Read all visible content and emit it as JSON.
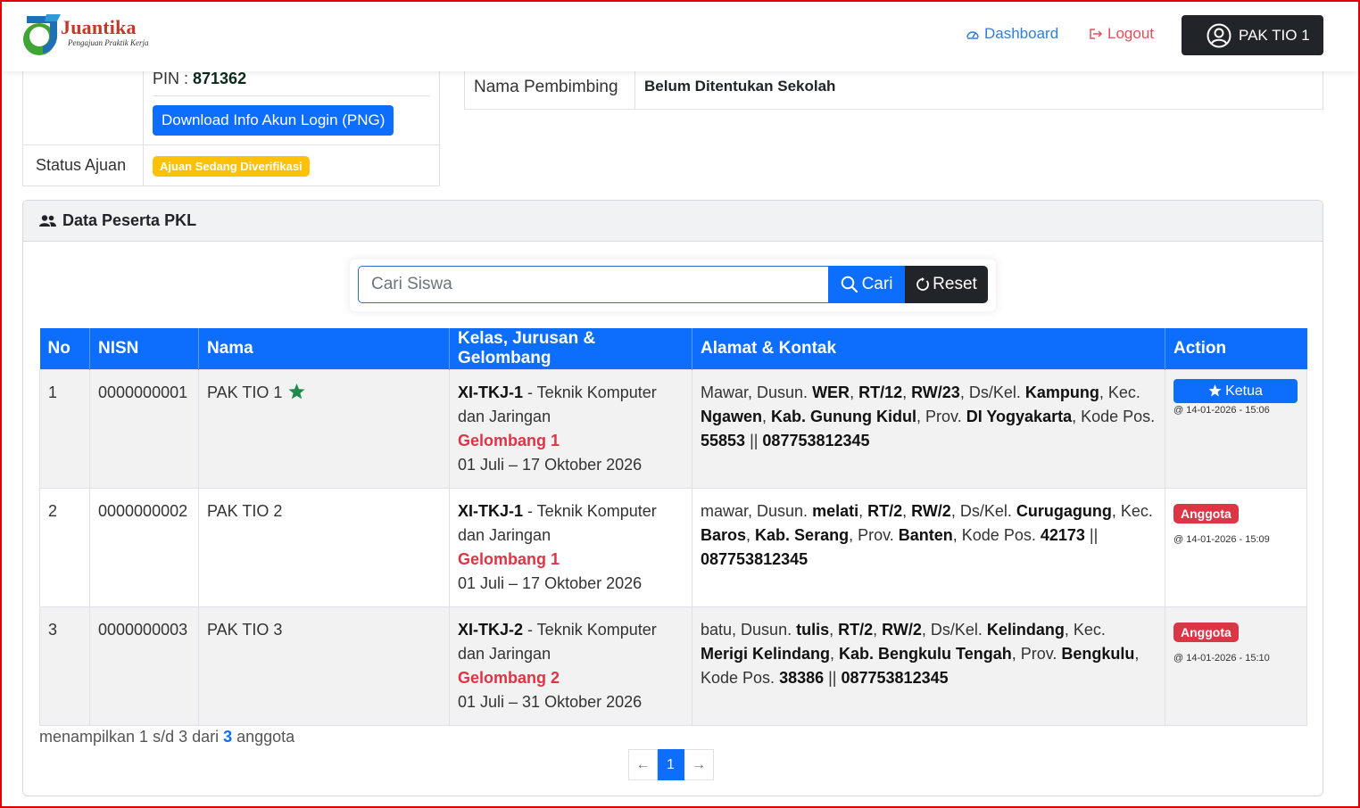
{
  "brand": {
    "title": "Juantika",
    "subtitle": "Pengajuan Praktik Kerja"
  },
  "nav": {
    "dashboard": "Dashboard",
    "logout": "Logout",
    "user": "PAK TIO 1"
  },
  "account": {
    "pin_label": "PIN : ",
    "pin_value": "871362",
    "download_button": "Download Info Akun Login (PNG)",
    "status_label": "Status Ajuan",
    "status_value": "Ajuan Sedang Diverifikasi"
  },
  "pembimbing": {
    "label": "Nama Pembimbing",
    "value": "Belum Ditentukan Sekolah"
  },
  "card": {
    "title": "Data Peserta PKL"
  },
  "search": {
    "placeholder": "Cari Siswa",
    "cari": "Cari",
    "reset": "Reset"
  },
  "table": {
    "headers": [
      "No",
      "NISN",
      "Nama",
      "Kelas, Jurusan & Gelombang",
      "Alamat & Kontak",
      "Action"
    ],
    "rows": [
      {
        "no": "1",
        "nisn": "0000000001",
        "nama": "PAK TIO 1",
        "kelas": "XI-TKJ-1",
        "jurusan": " - Teknik Komputer dan Jaringan",
        "gelombang": "Gelombang 1",
        "periode": "01 Juli – 17 Oktober 2026",
        "alamat": {
          "jalan": "Mawar",
          "dusun": "WER",
          "rt": "RT/12",
          "rw": "RW/23",
          "desa": "Kampung",
          "kec": "Ngawen",
          "kab": "Kab. Gunung Kidul",
          "prov": "DI Yogyakarta",
          "kodepos": "55853",
          "telp": "087753812345"
        },
        "role": "Ketua",
        "timestamp": "@ 14-01-2026 - 15:06"
      },
      {
        "no": "2",
        "nisn": "0000000002",
        "nama": "PAK TIO 2",
        "kelas": "XI-TKJ-1",
        "jurusan": " - Teknik Komputer dan Jaringan",
        "gelombang": "Gelombang 1",
        "periode": "01 Juli – 17 Oktober 2026",
        "alamat": {
          "jalan": "mawar",
          "dusun": "melati",
          "rt": "RT/2",
          "rw": "RW/2",
          "desa": "Curugagung",
          "kec": "Baros",
          "kab": "Kab. Serang",
          "prov": "Banten",
          "kodepos": "42173",
          "telp": "087753812345"
        },
        "role": "Anggota",
        "timestamp": "@ 14-01-2026 - 15:09"
      },
      {
        "no": "3",
        "nisn": "0000000003",
        "nama": "PAK TIO 3",
        "kelas": "XI-TKJ-2",
        "jurusan": " - Teknik Komputer dan Jaringan",
        "gelombang": "Gelombang 2",
        "periode": "01 Juli – 31 Oktober 2026",
        "alamat": {
          "jalan": "batu",
          "dusun": "tulis",
          "rt": "RT/2",
          "rw": "RW/2",
          "desa": "Kelindang",
          "kec": "Merigi Kelindang",
          "kab": "Kab. Bengkulu Tengah",
          "prov": "Bengkulu",
          "kodepos": "38386",
          "telp": "087753812345"
        },
        "role": "Anggota",
        "timestamp": "@ 14-01-2026 - 15:10"
      }
    ]
  },
  "summary": {
    "prefix": "menampilkan 1 s/d 3 dari ",
    "total": "3",
    "suffix": " anggota"
  },
  "pagination": {
    "prev": "←",
    "current": "1",
    "next": "→"
  },
  "colors": {
    "primary": "#0d6efd",
    "danger": "#dc3545",
    "warning": "#ffc107",
    "dark": "#212529",
    "star": "#1e8a4c"
  }
}
